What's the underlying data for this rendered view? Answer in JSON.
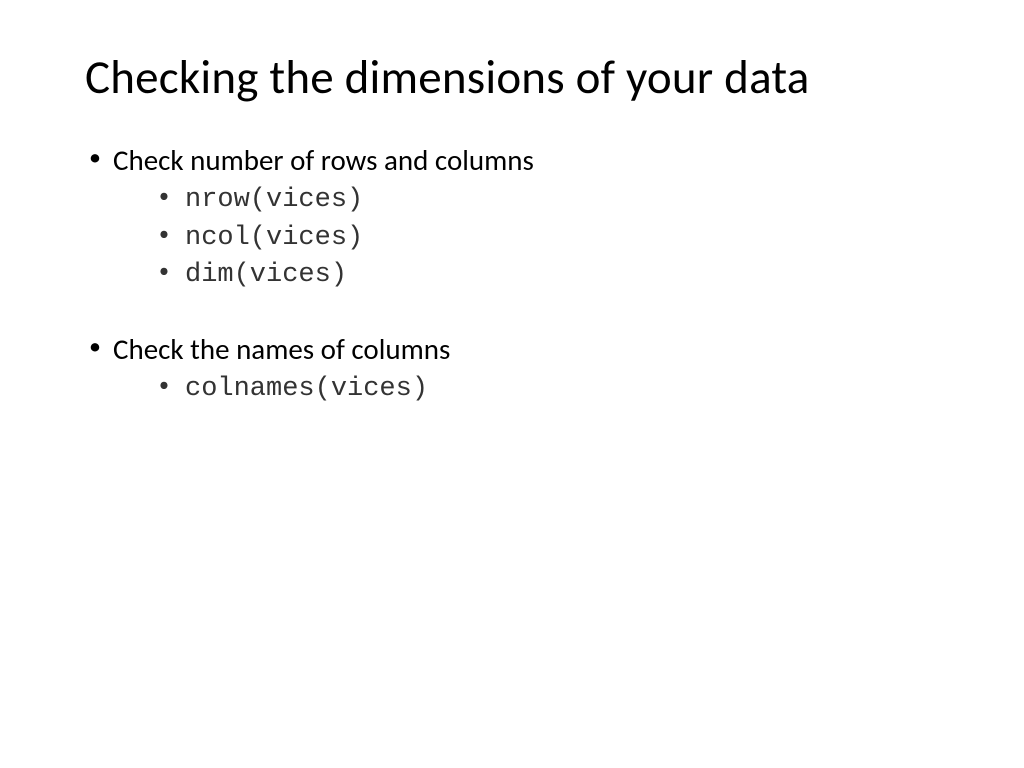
{
  "slide": {
    "title": "Checking the dimensions of your data",
    "bullets": [
      {
        "text": "Check number of rows and columns",
        "code_items": [
          "nrow(vices)",
          "ncol(vices)",
          "dim(vices)"
        ]
      },
      {
        "text": "Check the names of columns",
        "code_items": [
          "colnames(vices)"
        ]
      }
    ]
  }
}
